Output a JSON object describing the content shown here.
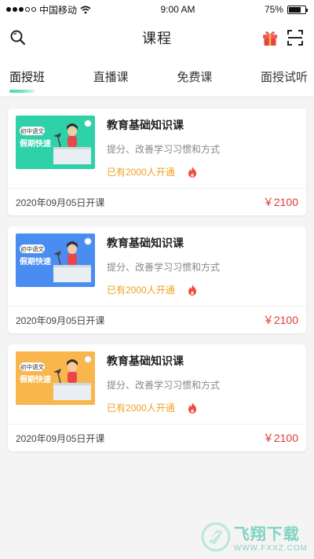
{
  "status_bar": {
    "carrier": "中国移动",
    "time": "9:00 AM",
    "battery": "75%",
    "battery_level": 0.75
  },
  "header": {
    "title": "课程",
    "icons": [
      "search-icon",
      "gift-icon",
      "scan-icon"
    ]
  },
  "tabs": [
    {
      "label": "面授班",
      "active": true
    },
    {
      "label": "直播课",
      "active": false
    },
    {
      "label": "免费课",
      "active": false
    },
    {
      "label": "面授试听",
      "active": false
    }
  ],
  "courses": [
    {
      "title": "教育基础知识课",
      "desc": "提分、改善学习习惯和方式",
      "enrolled": "已有2000人开通",
      "date": "2020年09月05日开课",
      "price": "￥2100",
      "thumb_tag": "初中语文",
      "thumb_text": "假期快速",
      "thumb_color": "#2ed1a8"
    },
    {
      "title": "教育基础知识课",
      "desc": "提分、改善学习习惯和方式",
      "enrolled": "已有2000人开通",
      "date": "2020年09月05日开课",
      "price": "￥2100",
      "thumb_tag": "初中语文",
      "thumb_text": "假期快速",
      "thumb_color": "#4a8df0"
    },
    {
      "title": "教育基础知识课",
      "desc": "提分、改善学习习惯和方式",
      "enrolled": "已有2000人开通",
      "date": "2020年09月05日开课",
      "price": "￥2100",
      "thumb_tag": "初中语文",
      "thumb_text": "假期快速",
      "thumb_color": "#f8b64c"
    }
  ],
  "watermark": {
    "name": "飞翔下载",
    "url": "WWW.FXXZ.COM"
  },
  "colors": {
    "accent": "#4cd6b6",
    "price": "#e03a3a",
    "enrolled": "#f0a020"
  }
}
